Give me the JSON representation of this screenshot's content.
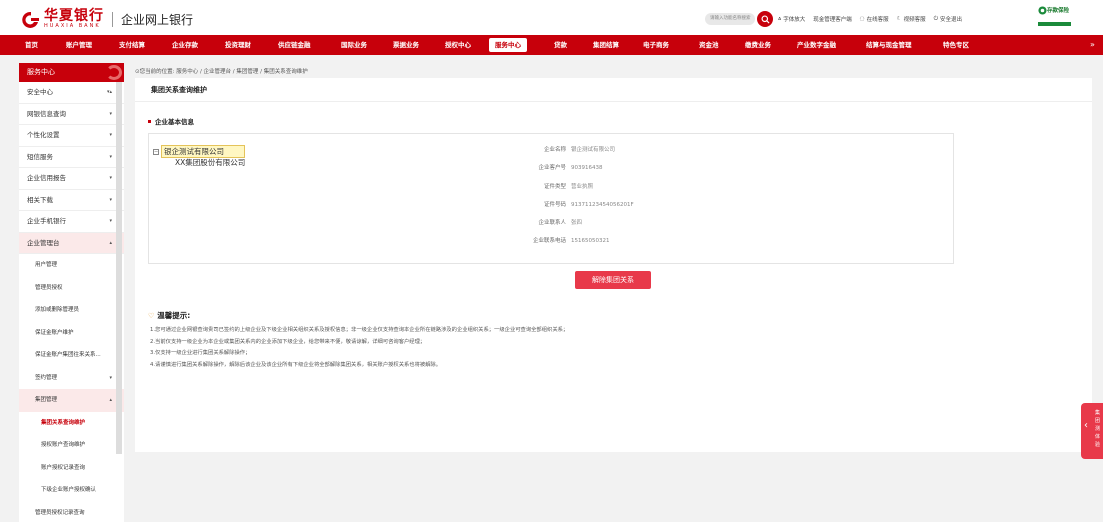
{
  "header": {
    "logo_cn": "华夏银行",
    "logo_en": "HUAXIA BANK",
    "app_title": "企业网上银行",
    "search_placeholder": "请输入功能名称搜索",
    "links": [
      "字体放大",
      "现金管理客户端",
      "在线客服",
      "视频客服",
      "安全退出"
    ],
    "brand_right": "存款保险"
  },
  "nav": {
    "items": [
      "首页",
      "账户管理",
      "支付结算",
      "企业存款",
      "投资理财",
      "供应链金融",
      "国际业务",
      "票据业务",
      "授权中心",
      "服务中心",
      "贷款",
      "集团结算",
      "电子商务",
      "资金池",
      "缴费业务",
      "产业数字金融",
      "结算与现金管理",
      "特色专区"
    ],
    "active": "服务中心"
  },
  "sidebar": {
    "header": "服务中心",
    "items": [
      {
        "label": "安全中心"
      },
      {
        "label": "网银信息查询"
      },
      {
        "label": "个性化设置"
      },
      {
        "label": "短信服务"
      },
      {
        "label": "企业信用报告"
      },
      {
        "label": "相关下载"
      },
      {
        "label": "企业手机银行"
      },
      {
        "label": "企业管理台"
      }
    ],
    "sub_items": [
      "用户管理",
      "管理员授权",
      "添加或删除管理员",
      "保证金账户维护",
      "保证金账户集团往来关系...",
      "签约管理",
      "集团管理"
    ],
    "group_items": [
      "集团关系查询维护",
      "授权账户查询维护",
      "账户授权记录查询",
      "下级企业账户授权确认",
      "管理员授权记录查询"
    ]
  },
  "breadcrumb": "您当前的位置: 服务中心 / 企业管理台 / 集团管理 / 集团关系查询维护",
  "main": {
    "page_title": "集团关系查询维护",
    "section_title": "企业基本信息",
    "tree": {
      "root": "银企测试有限公司",
      "child": "XX集团股份有限公司"
    },
    "fields": [
      {
        "label": "企业名称",
        "value": "银企测试有限公司"
      },
      {
        "label": "企业客户号",
        "value": "903916438"
      },
      {
        "label": "证件类型",
        "value": "营业执照"
      },
      {
        "label": "证件号码",
        "value": "91371123454056201F"
      },
      {
        "label": "企业联系人",
        "value": "张四"
      },
      {
        "label": "企业联系电话",
        "value": "15165050321"
      }
    ],
    "release_button": "解除集团关系",
    "tips_title": "温馨提示:",
    "tips": [
      "1.您可通过企业网银查询贵司已签约的上级企业及下级企业相关组织关系及授权信息；非一级企业仅支持查询本企业所在链路涉及的企业组织关系；一级企业可查询全部组织关系；",
      "2.当前仅支持一级企业为本企业或集团关系内的企业添加下级企业，给您带来不便，敬请谅解，详细可咨询客户经理；",
      "3.仅支持一级企业进行集团关系解除操作；",
      "4.请谨慎进行集团关系解除操作，解除后该企业及该企业所有下级企业将全部解除集团关系，相关账户授权关系也将被解除。"
    ]
  },
  "float_tab": "集团测体验"
}
